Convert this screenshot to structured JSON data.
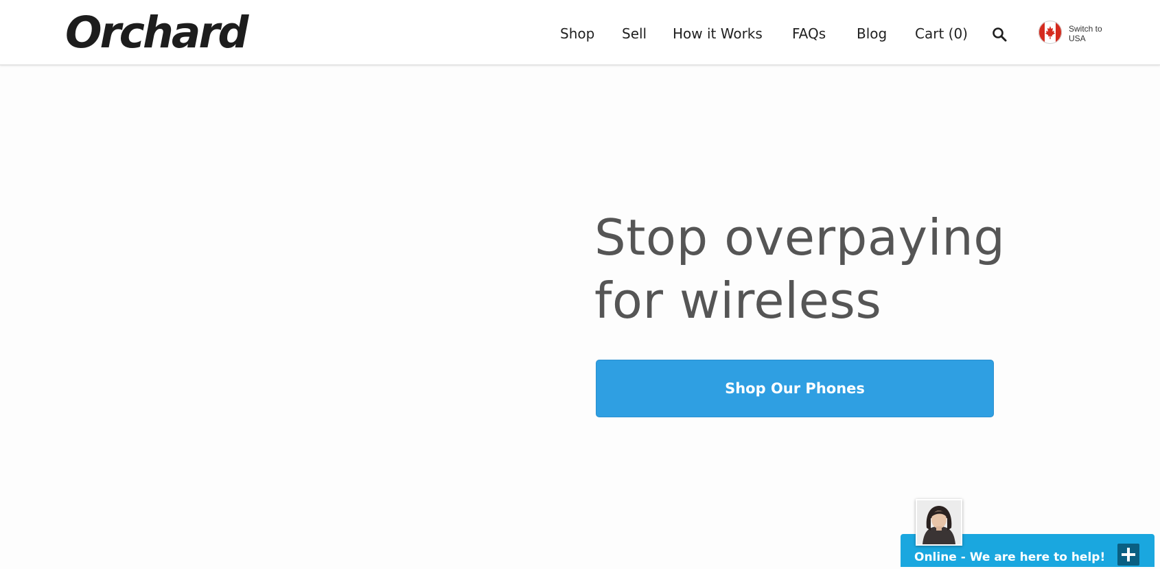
{
  "brand": {
    "logo_text": "Orchard"
  },
  "nav": {
    "items": [
      {
        "label": "Shop"
      },
      {
        "label": "Sell"
      },
      {
        "label": "How it Works"
      },
      {
        "label": "FAQs"
      },
      {
        "label": "Blog"
      },
      {
        "label": "Cart (0)"
      }
    ],
    "search_icon": "search-icon",
    "region": {
      "flag_icon": "canada-flag-icon",
      "line1": "Switch to",
      "line2": "USA"
    }
  },
  "hero": {
    "title_line1": "Stop overpaying",
    "title_line2": "for wireless",
    "cta_label": "Shop Our Phones"
  },
  "chat": {
    "status_text": "Online - We are here to help!",
    "expand_icon": "plus-icon"
  },
  "colors": {
    "cta": "#2f9fe2",
    "chat_bar": "#1aa7df",
    "chat_button": "#0a5f82",
    "hero_text": "#555555",
    "flag_red": "#d52b1e"
  }
}
